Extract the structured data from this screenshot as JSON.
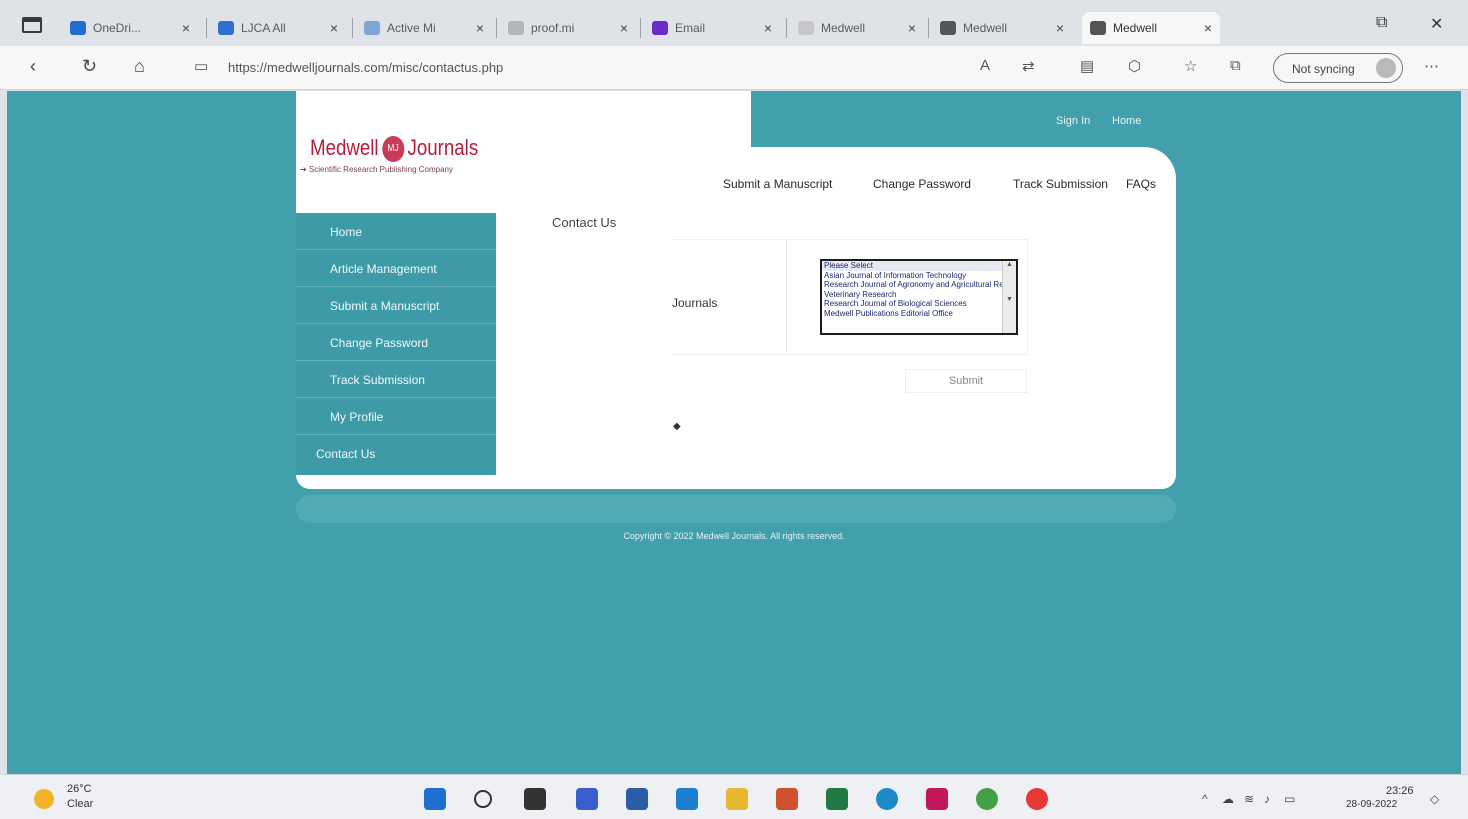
{
  "browser": {
    "tabs": [
      {
        "label": "OneDri...",
        "color": "#1f6fd1",
        "active": false
      },
      {
        "label": "LJCA All",
        "color": "#2f6fcf",
        "active": false
      },
      {
        "label": "Active Mi",
        "color": "#7ea5d6",
        "active": false
      },
      {
        "label": "proof.mi",
        "color": "#b5b5b5",
        "active": false
      },
      {
        "label": "Email",
        "color": "#6a2cc7",
        "active": false
      },
      {
        "label": "Medwell",
        "color": "#c7c7c7",
        "active": false
      },
      {
        "label": "Medwell",
        "color": "#555555",
        "active": false
      },
      {
        "label": "Medwell",
        "color": "#555555",
        "active": true
      }
    ],
    "url": "https://medwelljournals.com/misc/contactus.php",
    "profile_label": "Not syncing",
    "window_restore_glyph": "⧉",
    "window_close_glyph": "✕"
  },
  "site": {
    "logo_left": "Medwell",
    "logo_badge": "MJ",
    "logo_right": "Journals",
    "logo_tagline": "Scientific Research Publishing Company",
    "top_links": [
      "Sign In",
      "Home"
    ],
    "nav": [
      "Submit a Manuscript",
      "Change Password",
      "Track Submission",
      "FAQs"
    ],
    "sidebar": [
      "Home",
      "Article Management",
      "Submit a Manuscript",
      "Change Password",
      "Track Submission",
      "My Profile",
      "Contact Us"
    ],
    "contact_title": "Contact Us",
    "form_label": "Journals",
    "journal_options": [
      "Please Select",
      "Asian Journal of Information Technology",
      "Research Journal of Agronomy and Agricultural Research",
      "Veterinary Research",
      "Research Journal of Biological Sciences",
      "Medwell Publications Editorial Office"
    ],
    "submit_label": "Submit",
    "copyright": "Copyright © 2022 Medwell Journals. All rights reserved."
  },
  "taskbar": {
    "weather_temp": "26°C",
    "weather_desc": "Clear",
    "clock_time": "23:26",
    "clock_date": "28-09-2022"
  }
}
